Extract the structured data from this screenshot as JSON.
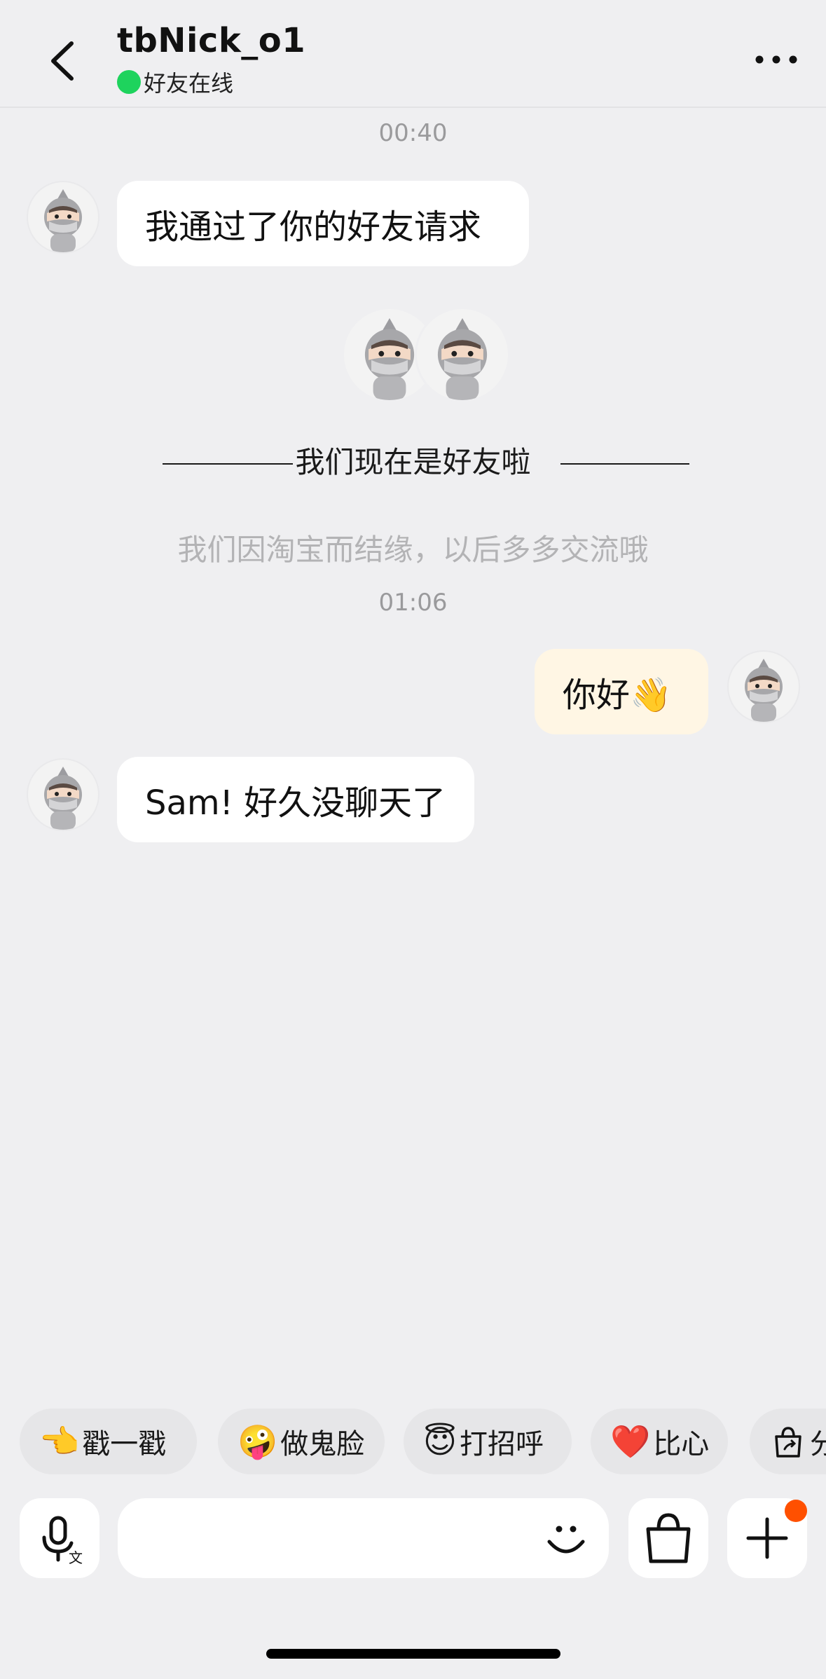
{
  "header": {
    "title": "tbNick_o1",
    "status": "好友在线",
    "status_color": "#1ed35d",
    "back_icon": "chevron-left-icon",
    "more_icon": "more-dots-icon"
  },
  "messages": {
    "time_1": "00:40",
    "msg_1": "我通过了你的好友请求",
    "friend_notice": "我们现在是好友啦",
    "friend_hint": "我们因淘宝而结缘，以后多多交流哦",
    "time_2": "01:06",
    "msg_2": "你好👋",
    "msg_3": "Sam! 好久没聊天了"
  },
  "quick_actions": [
    {
      "emoji": "👈",
      "label": "戳一戳"
    },
    {
      "emoji": "🤪",
      "label": "做鬼脸"
    },
    {
      "emoji": "😇",
      "label": "打招呼"
    },
    {
      "emoji": "❤️",
      "label": "比心"
    },
    {
      "emoji": "",
      "label": "分"
    }
  ],
  "input_bar": {
    "placeholder": "",
    "voice_icon": "voice-translate-icon",
    "emoji_icon": "smile-icon",
    "shop_icon": "shopping-bag-icon",
    "plus_icon": "plus-icon",
    "badge_color": "#ff5000"
  },
  "colors": {
    "background": "#efeff1",
    "my_bubble": "#fff6e4",
    "their_bubble": "#ffffff"
  }
}
